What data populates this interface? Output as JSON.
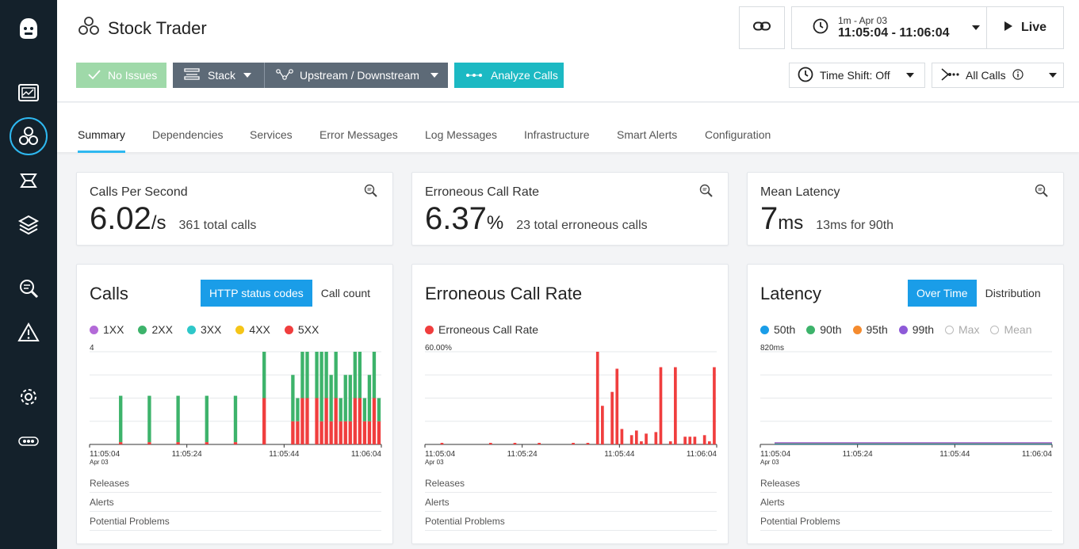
{
  "app": {
    "title": "Stock Trader"
  },
  "nav": {
    "items": [
      "logo-icon",
      "dashboard-icon",
      "applications-icon",
      "infrastructure-icon",
      "platforms-icon",
      "analytics-icon",
      "alerts-icon",
      "settings-icon",
      "more-icon"
    ],
    "active": "applications-icon",
    "accent": "#2eb8f0"
  },
  "header": {
    "no_issues": "No Issues",
    "stack": "Stack",
    "upstream": "Upstream / Downstream",
    "analyze": "Analyze Calls",
    "time_range": "1m - Apr 03",
    "time_window": "11:05:04 - 11:06:04",
    "live": "Live",
    "time_shift": "Time Shift: Off",
    "all_calls": "All Calls"
  },
  "tabs": [
    "Summary",
    "Dependencies",
    "Services",
    "Error Messages",
    "Log Messages",
    "Infrastructure",
    "Smart Alerts",
    "Configuration"
  ],
  "active_tab": "Summary",
  "metrics": [
    {
      "label": "Calls Per Second",
      "value": "6.02",
      "unit": "/s",
      "sub": "361 total calls"
    },
    {
      "label": "Erroneous Call Rate",
      "value": "6.37",
      "unit": "%",
      "sub": "23 total erroneous calls"
    },
    {
      "label": "Mean Latency",
      "value": "7",
      "unit": "ms",
      "sub": "13ms for 90th"
    }
  ],
  "panels": {
    "calls": {
      "title": "Calls",
      "toggle": [
        "HTTP status codes",
        "Call count"
      ],
      "legend": [
        {
          "name": "1XX",
          "color": "#b36ad8"
        },
        {
          "name": "2XX",
          "color": "#3db36b"
        },
        {
          "name": "3XX",
          "color": "#2ec7c9"
        },
        {
          "name": "4XX",
          "color": "#f5c518"
        },
        {
          "name": "5XX",
          "color": "#f03e3e"
        }
      ],
      "ymax_label": "4"
    },
    "error_rate": {
      "title": "Erroneous Call Rate",
      "legend": [
        {
          "name": "Erroneous Call Rate",
          "color": "#f03e3e"
        }
      ],
      "ymax_label": "60.00%"
    },
    "latency": {
      "title": "Latency",
      "toggle": [
        "Over Time",
        "Distribution"
      ],
      "legend": [
        {
          "name": "50th",
          "color": "#1a9de8"
        },
        {
          "name": "90th",
          "color": "#3db36b"
        },
        {
          "name": "95th",
          "color": "#f58b2e"
        },
        {
          "name": "99th",
          "color": "#8e5ad8"
        },
        {
          "name": "Max",
          "color": "#bbbbbb",
          "hollow": true
        },
        {
          "name": "Mean",
          "color": "#bbbbbb",
          "hollow": true
        }
      ],
      "ymax_label": "820ms"
    },
    "x_ticks": [
      "11:05:04",
      "11:05:24",
      "11:05:44",
      "11:06:04"
    ],
    "x_date": "Apr 03",
    "rows": [
      "Releases",
      "Alerts",
      "Potential Problems"
    ]
  },
  "chart_data": [
    {
      "type": "bar",
      "title": "Calls",
      "ylim": [
        0,
        4
      ],
      "x_start": "11:05:04",
      "x_end": "11:06:04",
      "series": [
        {
          "name": "2XX",
          "values": [
            0,
            0,
            0,
            0,
            0,
            0,
            2,
            0,
            0,
            0,
            0,
            0,
            2,
            0,
            0,
            0,
            0,
            0,
            2,
            0,
            0,
            0,
            0,
            0,
            2,
            0,
            0,
            0,
            0,
            0,
            2,
            0,
            0,
            0,
            0,
            0,
            2,
            0,
            0,
            0,
            0,
            0,
            2,
            1,
            2,
            2,
            0,
            2,
            3,
            2,
            2,
            2,
            1,
            2,
            2,
            2,
            2,
            1,
            2,
            2,
            1
          ]
        },
        {
          "name": "5XX",
          "values": [
            0,
            0,
            0,
            0,
            0,
            0,
            0.1,
            0,
            0,
            0,
            0,
            0,
            0.1,
            0,
            0,
            0,
            0,
            0,
            0.1,
            0,
            0,
            0,
            0,
            0,
            0.1,
            0,
            0,
            0,
            0,
            0,
            0.1,
            0,
            0,
            0,
            0,
            0,
            2,
            0,
            0,
            0,
            0,
            0,
            1,
            1,
            2,
            2,
            0,
            2,
            1,
            2,
            1,
            2,
            1,
            1,
            1,
            2,
            2,
            1,
            1,
            2,
            1
          ]
        }
      ]
    },
    {
      "type": "bar",
      "title": "Erroneous Call Rate",
      "ylim": [
        0,
        60
      ],
      "x_start": "11:05:04",
      "x_end": "11:06:04",
      "series": [
        {
          "name": "Erroneous Call Rate",
          "values": [
            0,
            0,
            0,
            1,
            0,
            0,
            0,
            0,
            0,
            0,
            0,
            0,
            0,
            1,
            0,
            0,
            0,
            0,
            1,
            0,
            0,
            0,
            0,
            1,
            0,
            0,
            0,
            0,
            0,
            0,
            1,
            0,
            0,
            1,
            0,
            60,
            25,
            0,
            34,
            49,
            10,
            0,
            6,
            9,
            2,
            7,
            0,
            8,
            50,
            0,
            2,
            50,
            0,
            5,
            5,
            5,
            0,
            6,
            2,
            50
          ]
        }
      ]
    },
    {
      "type": "line",
      "title": "Latency",
      "ylim": [
        0,
        820
      ],
      "x_start": "11:05:04",
      "x_end": "11:06:04",
      "series": [
        {
          "name": "50th",
          "values": [
            5,
            5,
            5,
            5,
            5,
            5,
            5,
            5,
            5,
            5,
            5,
            5,
            5,
            5,
            5,
            5,
            5,
            5,
            5,
            5,
            5,
            5,
            5,
            5,
            5,
            5,
            5,
            5,
            5,
            5,
            5,
            5,
            5,
            5,
            5,
            5,
            5,
            5,
            5,
            5,
            5,
            5,
            5,
            5,
            5,
            5,
            5,
            5,
            5,
            5,
            5,
            5,
            5,
            5,
            5,
            5,
            5,
            5,
            5,
            5,
            5
          ]
        },
        {
          "name": "90th",
          "values": [
            10,
            10,
            10,
            10,
            10,
            10,
            10,
            10,
            10,
            10,
            10,
            10,
            10,
            10,
            10,
            10,
            10,
            10,
            10,
            10,
            10,
            10,
            10,
            10,
            10,
            10,
            10,
            10,
            10,
            10,
            10,
            10,
            10,
            10,
            10,
            10,
            10,
            10,
            10,
            10,
            10,
            10,
            10,
            10,
            10,
            10,
            10,
            10,
            10,
            10,
            10,
            10,
            10,
            10,
            10,
            10,
            10,
            10,
            10,
            10,
            10
          ]
        },
        {
          "name": "95th",
          "values": [
            12,
            12,
            12,
            12,
            12,
            12,
            12,
            12,
            12,
            12,
            12,
            12,
            12,
            12,
            12,
            12,
            12,
            12,
            12,
            12,
            12,
            12,
            12,
            12,
            12,
            12,
            12,
            12,
            12,
            12,
            12,
            12,
            12,
            12,
            12,
            12,
            12,
            12,
            12,
            12,
            12,
            12,
            12,
            12,
            12,
            12,
            12,
            12,
            12,
            12,
            12,
            12,
            12,
            12,
            12,
            12,
            12,
            12,
            12,
            12,
            12
          ]
        },
        {
          "name": "99th",
          "values": [
            15,
            15,
            15,
            15,
            15,
            15,
            15,
            15,
            15,
            15,
            15,
            15,
            15,
            15,
            15,
            15,
            15,
            15,
            15,
            15,
            15,
            15,
            15,
            15,
            15,
            15,
            15,
            15,
            15,
            15,
            15,
            15,
            15,
            15,
            15,
            15,
            15,
            15,
            15,
            15,
            15,
            15,
            15,
            15,
            15,
            15,
            15,
            15,
            15,
            15,
            15,
            15,
            15,
            15,
            15,
            15,
            15,
            15,
            15,
            15,
            15
          ]
        }
      ]
    }
  ]
}
